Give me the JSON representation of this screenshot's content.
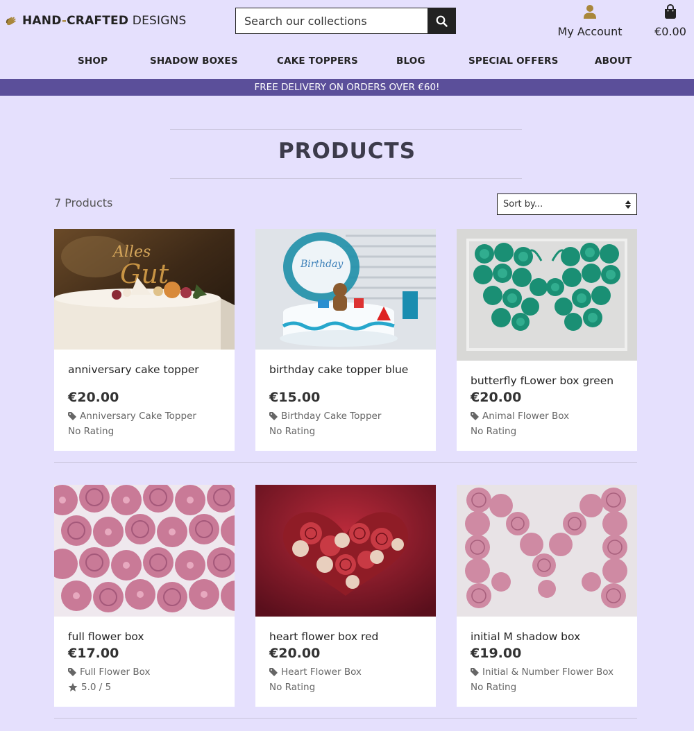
{
  "header": {
    "logo_bold": "HAND",
    "logo_dash": "-",
    "logo_bold2": "CRAFTED",
    "logo_rest": " DESIGNS",
    "search_placeholder": "Search our collections",
    "account_label": "My Account",
    "bag_total": "€0.00"
  },
  "nav": {
    "items": [
      "SHOP",
      "SHADOW BOXES",
      "CAKE TOPPERS",
      "BLOG",
      "SPECIAL OFFERS",
      "ABOUT"
    ]
  },
  "banner": "FREE DELIVERY ON ORDERS OVER €60!",
  "page": {
    "title": "PRODUCTS",
    "count": "7 Products",
    "sort_label": "Sort by..."
  },
  "products": [
    {
      "name": "anniversary cake topper",
      "price": "€20.00",
      "category": "Anniversary Cake Topper",
      "rating": "No Rating"
    },
    {
      "name": "birthday cake topper blue",
      "price": "€15.00",
      "category": "Birthday Cake Topper",
      "rating": "No Rating"
    },
    {
      "name": "butterfly fLower box green",
      "price": "€20.00",
      "category": "Animal Flower Box",
      "rating": "No Rating"
    },
    {
      "name": "full flower box",
      "price": "€17.00",
      "category": "Full Flower Box",
      "rating": "5.0 / 5"
    },
    {
      "name": "heart flower box red",
      "price": "€20.00",
      "category": "Heart Flower Box",
      "rating": "No Rating"
    },
    {
      "name": "initial M shadow box",
      "price": "€19.00",
      "category": "Initial & Number Flower Box",
      "rating": "No Rating"
    }
  ],
  "colors": {
    "page_bg": "#e5e0fd",
    "banner_bg": "#5b4f9a",
    "accent_gold": "#a9873b",
    "text_dark": "#222222"
  },
  "icons": [
    "logo-hands-icon",
    "search-icon",
    "user-icon",
    "shopping-bag-icon",
    "sort-arrows-icon",
    "tag-icon",
    "star-icon"
  ]
}
